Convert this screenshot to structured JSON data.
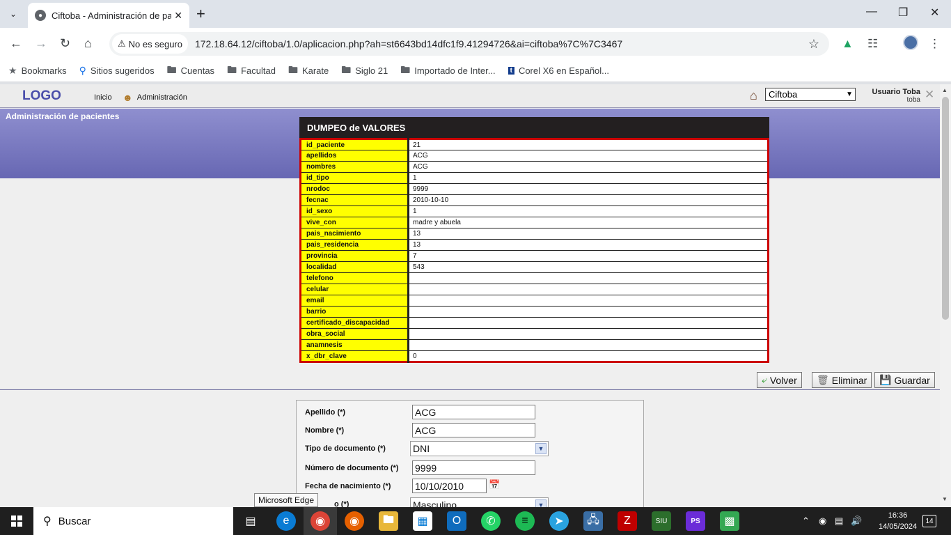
{
  "browser": {
    "tab_title": "Ciftoba - Administración de pac",
    "security_label": "No es seguro",
    "url": "172.18.64.12/ciftoba/1.0/aplicacion.php?ah=st6643bd14dfc1f9.41294726&ai=ciftoba%7C%7C3467",
    "bookmarks": [
      "Bookmarks",
      "Sitios sugeridos",
      "Cuentas",
      "Facultad",
      "Karate",
      "Siglo 21",
      "Importado de Inter...",
      "Corel X6 en Español..."
    ]
  },
  "app": {
    "logo": "LOGO",
    "menu": {
      "inicio": "Inicio",
      "administracion": "Administración"
    },
    "project_selected": "Ciftoba",
    "user": {
      "name": "Usuario Toba",
      "login": "toba"
    },
    "section_title": "Administración de pacientes"
  },
  "dump": {
    "title": "DUMPEO de VALORES",
    "rows": [
      {
        "k": "id_paciente",
        "v": "21"
      },
      {
        "k": "apellidos",
        "v": "ACG"
      },
      {
        "k": "nombres",
        "v": "ACG"
      },
      {
        "k": "id_tipo",
        "v": "1"
      },
      {
        "k": "nrodoc",
        "v": "9999"
      },
      {
        "k": "fecnac",
        "v": "2010-10-10"
      },
      {
        "k": "id_sexo",
        "v": "1"
      },
      {
        "k": "vive_con",
        "v": "madre y abuela"
      },
      {
        "k": "pais_nacimiento",
        "v": "13"
      },
      {
        "k": "pais_residencia",
        "v": "13"
      },
      {
        "k": "provincia",
        "v": "7"
      },
      {
        "k": "localidad",
        "v": "543"
      },
      {
        "k": "telefono",
        "v": ""
      },
      {
        "k": "celular",
        "v": ""
      },
      {
        "k": "email",
        "v": ""
      },
      {
        "k": "barrio",
        "v": ""
      },
      {
        "k": "certificado_discapacidad",
        "v": ""
      },
      {
        "k": "obra_social",
        "v": ""
      },
      {
        "k": "anamnesis",
        "v": ""
      },
      {
        "k": "x_dbr_clave",
        "v": "0"
      }
    ]
  },
  "actions": {
    "volver": "Volver",
    "eliminar": "Eliminar",
    "guardar": "Guardar"
  },
  "form": {
    "apellido": {
      "label": "Apellido (*)",
      "value": "ACG"
    },
    "nombre": {
      "label": "Nombre (*)",
      "value": "ACG"
    },
    "tipo_doc": {
      "label": "Tipo de documento (*)",
      "value": "DNI"
    },
    "nro_doc": {
      "label": "Número de documento (*)",
      "value": "9999"
    },
    "fecha_nac": {
      "label": "Fecha de nacimiento (*)",
      "value": "10/10/2010"
    },
    "sexo": {
      "label": "o (*)",
      "value": "Masculino"
    }
  },
  "tooltip": "Microsoft Edge",
  "taskbar": {
    "search": "Buscar",
    "time": "16:36",
    "date": "14/05/2024",
    "notifications": "14"
  }
}
